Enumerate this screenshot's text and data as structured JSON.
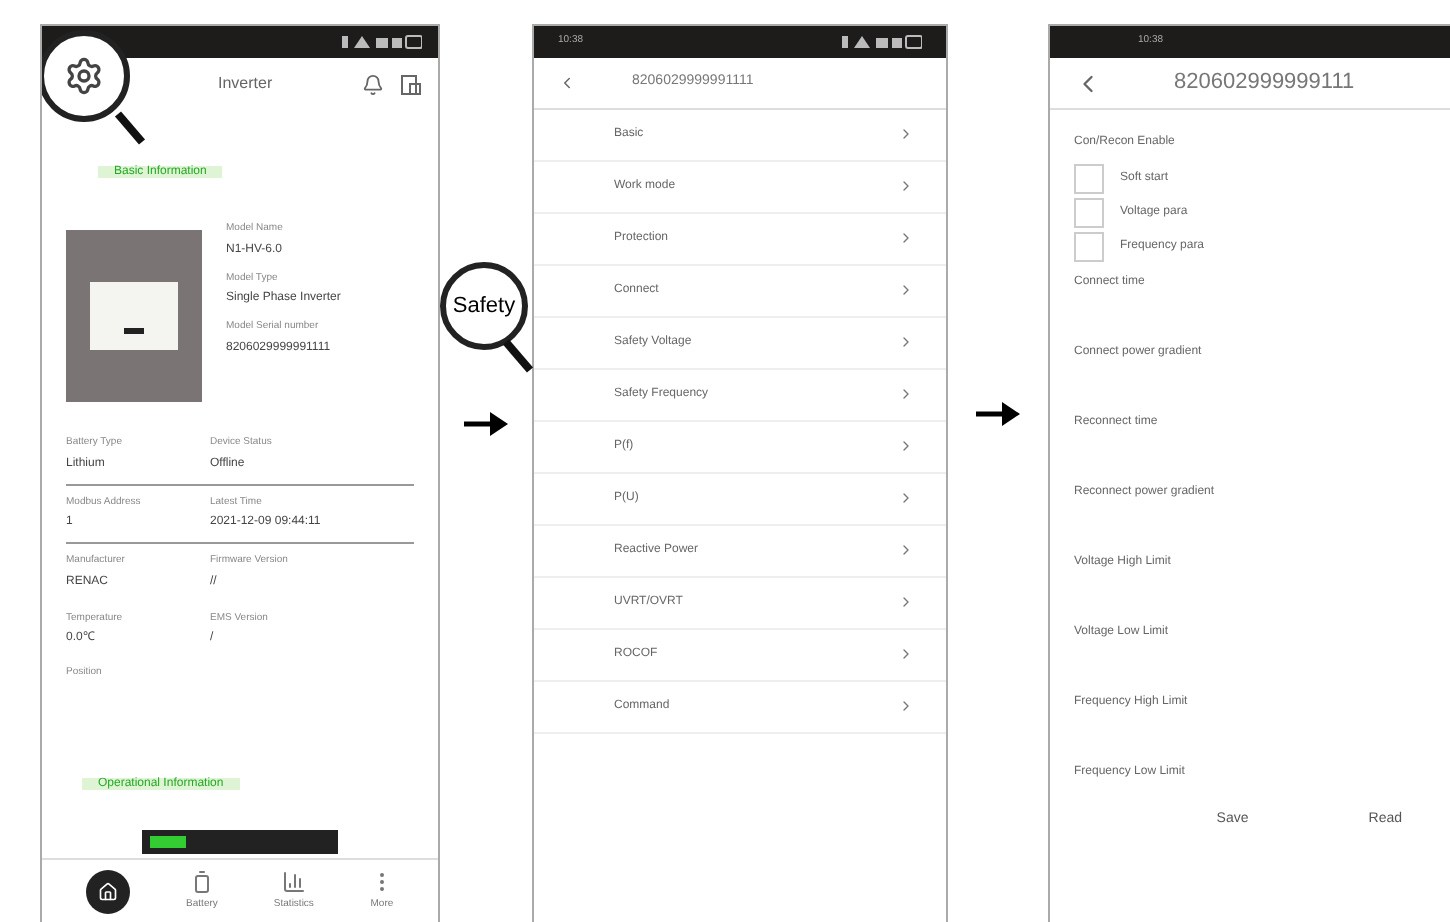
{
  "home_screen": {
    "title": "Inverter",
    "section_basic": "Basic Information",
    "model_fields": [
      {
        "label": "Model Name",
        "value": "N1-HV-6.0"
      },
      {
        "label": "Model Type",
        "value": "Single Phase Inverter"
      },
      {
        "label": "Model Serial number",
        "value": "8206029999991111"
      }
    ],
    "info_groups": [
      [
        {
          "label": "Battery Type",
          "value": "Lithium"
        },
        {
          "label": "Device Status",
          "value": "Offline"
        }
      ],
      [
        {
          "label": "Modbus Address",
          "value": "1"
        },
        {
          "label": "Latest Time",
          "value": "2021-12-09 09:44:11"
        }
      ],
      [
        {
          "label": "Manufacturer",
          "value": "RENAC"
        },
        {
          "label": "Firmware Version",
          "value": "//"
        }
      ],
      [
        {
          "label": "Temperature",
          "value": "0.0℃"
        },
        {
          "label": "EMS Version",
          "value": "/"
        }
      ]
    ],
    "position_label": "Position",
    "section_operational": "Operational Information",
    "nav": [
      {
        "label": "Battery"
      },
      {
        "label": "Statistics"
      },
      {
        "label": "More"
      }
    ]
  },
  "settings_menu": {
    "time": "10:38",
    "serial": "8206029999991111",
    "items": [
      "Basic",
      "Work mode",
      "Protection",
      "Connect",
      "Safety Voltage",
      "Safety Frequency",
      "P(f)",
      "P(U)",
      "Reactive Power",
      "UVRT/OVRT",
      "ROCOF",
      "Command"
    ],
    "magnifier_text": "Safety"
  },
  "safety_screen": {
    "time": "10:38",
    "serial": "820602999999111",
    "enable_label": "Con/Recon Enable",
    "options": [
      {
        "label": "Soft start",
        "checked": false
      },
      {
        "label": "Voltage para",
        "checked": false
      },
      {
        "label": "Frequency para",
        "checked": false
      }
    ],
    "fields": [
      "Connect time",
      "Connect power gradient",
      "Reconnect time",
      "Reconnect power gradient",
      "Voltage High Limit",
      "Voltage Low Limit",
      "Frequency High Limit",
      "Frequency Low Limit"
    ],
    "buttons": [
      "Save",
      "Read"
    ]
  }
}
